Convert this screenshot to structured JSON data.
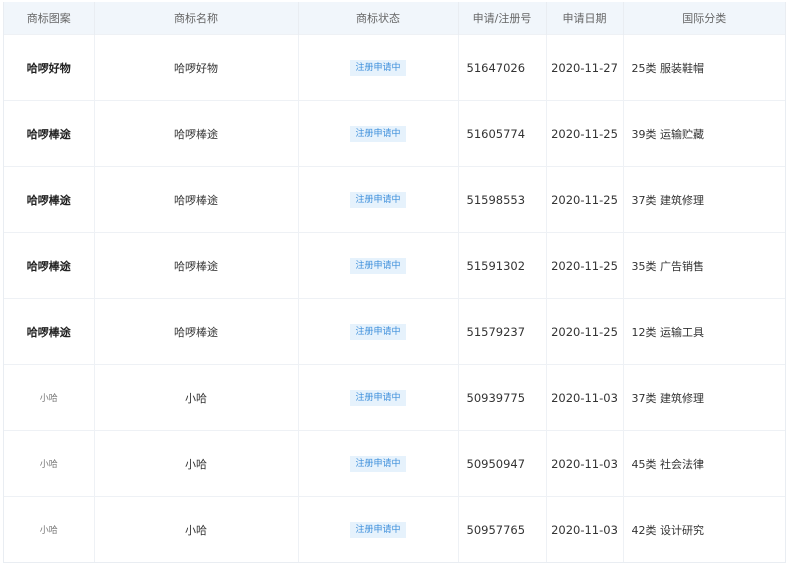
{
  "header": {
    "col_logo": "商标图案",
    "col_name": "商标名称",
    "col_status": "商标状态",
    "col_reg_no": "申请/注册号",
    "col_date": "申请日期",
    "col_class": "国际分类"
  },
  "colors": {
    "header_bg": "#f1f6fb",
    "badge_bg": "#e6f2fc",
    "badge_text": "#3d8fdb"
  },
  "rows": [
    {
      "logo_text": "哈啰好物",
      "name": "哈啰好物",
      "status": "注册申请中",
      "reg_no": "51647026",
      "date": "2020-11-27",
      "class": "25类 服装鞋帽"
    },
    {
      "logo_text": "哈啰棒途",
      "name": "哈啰棒途",
      "status": "注册申请中",
      "reg_no": "51605774",
      "date": "2020-11-25",
      "class": "39类 运输贮藏"
    },
    {
      "logo_text": "哈啰棒途",
      "name": "哈啰棒途",
      "status": "注册申请中",
      "reg_no": "51598553",
      "date": "2020-11-25",
      "class": "37类 建筑修理"
    },
    {
      "logo_text": "哈啰棒途",
      "name": "哈啰棒途",
      "status": "注册申请中",
      "reg_no": "51591302",
      "date": "2020-11-25",
      "class": "35类 广告销售"
    },
    {
      "logo_text": "哈啰棒途",
      "name": "哈啰棒途",
      "status": "注册申请中",
      "reg_no": "51579237",
      "date": "2020-11-25",
      "class": "12类 运输工具"
    },
    {
      "logo_text": "小哈",
      "name": "小哈",
      "status": "注册申请中",
      "reg_no": "50939775",
      "date": "2020-11-03",
      "class": "37类 建筑修理"
    },
    {
      "logo_text": "小哈",
      "name": "小哈",
      "status": "注册申请中",
      "reg_no": "50950947",
      "date": "2020-11-03",
      "class": "45类 社会法律"
    },
    {
      "logo_text": "小哈",
      "name": "小哈",
      "status": "注册申请中",
      "reg_no": "50957765",
      "date": "2020-11-03",
      "class": "42类 设计研究"
    }
  ]
}
